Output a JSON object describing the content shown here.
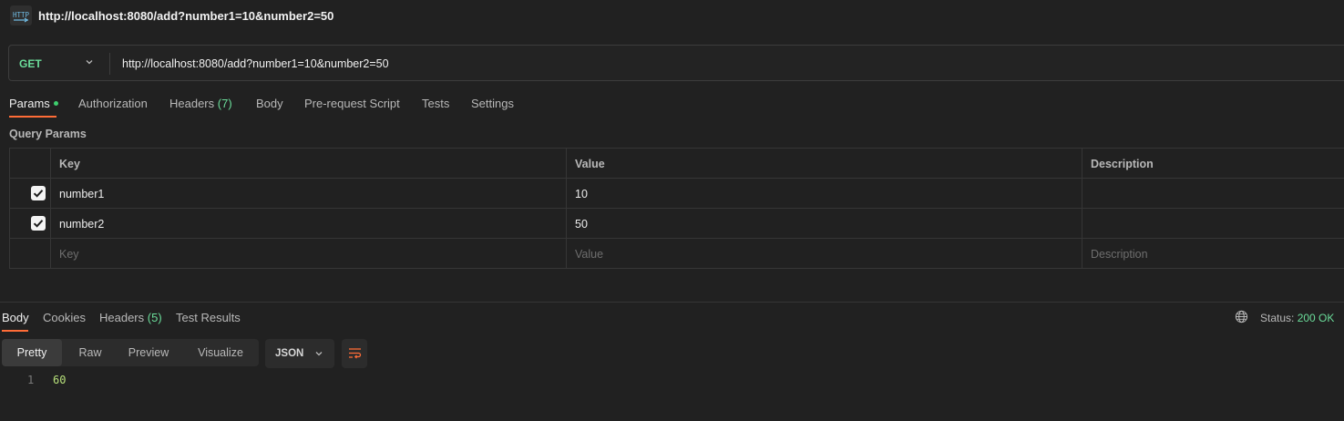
{
  "header": {
    "icon": "http-file-icon",
    "title": "http://localhost:8080/add?number1=10&number2=50"
  },
  "request": {
    "method": "GET",
    "url": "http://localhost:8080/add?number1=10&number2=50",
    "method_color": "#6bdd9a"
  },
  "request_tabs": [
    {
      "label": "Params",
      "active": true
    },
    {
      "label": "Authorization"
    },
    {
      "label": "Headers",
      "count": "(7)"
    },
    {
      "label": "Body"
    },
    {
      "label": "Pre-request Script"
    },
    {
      "label": "Tests"
    },
    {
      "label": "Settings"
    }
  ],
  "query_params": {
    "label": "Query Params",
    "headers": [
      "Key",
      "Value",
      "Description"
    ],
    "rows": [
      {
        "checked": true,
        "key": "number1",
        "value": "10",
        "description": ""
      },
      {
        "checked": true,
        "key": "number2",
        "value": "50",
        "description": ""
      }
    ],
    "placeholders": {
      "key": "Key",
      "value": "Value",
      "description": "Description"
    }
  },
  "response_tabs": [
    {
      "label": "Body",
      "active": true
    },
    {
      "label": "Cookies"
    },
    {
      "label": "Headers",
      "count": "(5)"
    },
    {
      "label": "Test Results"
    }
  ],
  "status": {
    "label": "Status:",
    "value": "200 OK"
  },
  "view_modes": [
    "Pretty",
    "Raw",
    "Preview",
    "Visualize"
  ],
  "format": "JSON",
  "response_body": [
    {
      "line": "1",
      "text": "60"
    }
  ],
  "colors": {
    "accent": "#ff6c37",
    "success": "#6bdd9a"
  }
}
